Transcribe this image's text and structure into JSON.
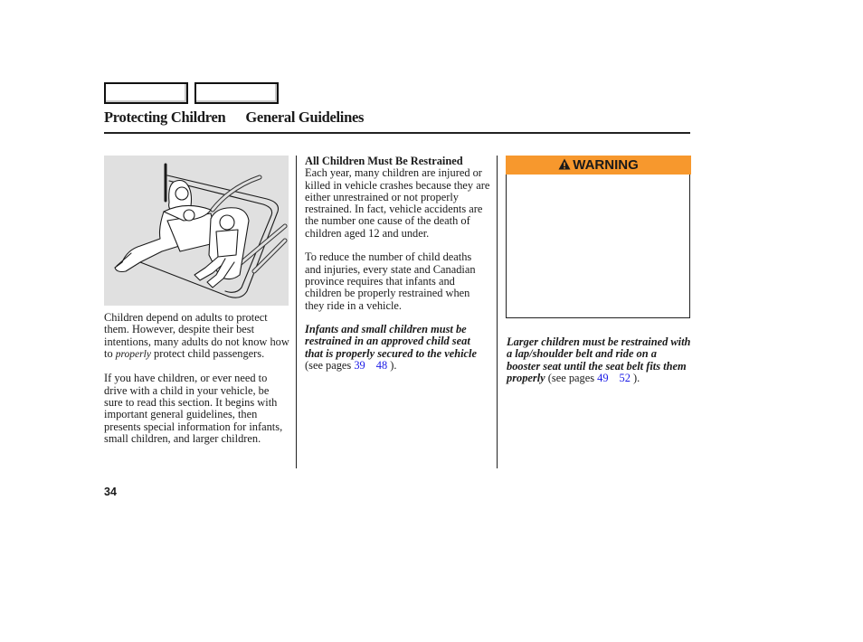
{
  "navigation": {
    "prev_button_label": "",
    "next_button_label": ""
  },
  "header": {
    "chapter": "Protecting Children",
    "section": "General Guidelines"
  },
  "illustration": {
    "alt": "Adult seated beside infant in carrier and child in child seat, secured by seat belts"
  },
  "left_column": {
    "p1_before": "Children depend on adults to protect them. However, despite their best intentions, many adults do not know how to ",
    "p1_emphasis": "properly",
    "p1_after": " protect child passengers.",
    "p2": "If you have children, or ever need to drive with a child in your vehicle, be sure to read this section. It begins with important general guidelines, then presents special information for infants, small children, and larger children."
  },
  "middle_column": {
    "heading": "All Children Must Be Restrained",
    "p1": "Each year, many children are injured or killed in vehicle crashes because they are either unrestrained or not properly restrained. In fact, vehicle accidents are the number one cause of the death of children aged 12 and under.",
    "p2": "To reduce the number of child deaths and injuries, every state and Canadian province requires that infants and children be properly restrained when they ride in a vehicle.",
    "p3_emphasis": "Infants and small children must be restrained in an approved child seat that is properly secured to the vehicle",
    "p3_ref_prefix": " (see pages ",
    "p3_link_start": "39",
    "p3_link_end": "48",
    "p3_ref_suffix": " )."
  },
  "right_column": {
    "warning_label": "WARNING",
    "warning_icon": "warning-triangle-icon",
    "warning_bar_color": "#f7982d",
    "warning_body": "",
    "p1_emphasis": "Larger children must be restrained with a lap/shoulder belt and ride on a booster seat until the seat belt fits them properly",
    "p1_ref_prefix": " (see pages ",
    "p1_link_start": "49",
    "p1_link_end": "52",
    "p1_ref_suffix": " )."
  },
  "footer": {
    "page_number": "34"
  },
  "colors": {
    "link": "#1a1ae6",
    "illustration_bg": "#e0e0e0"
  }
}
